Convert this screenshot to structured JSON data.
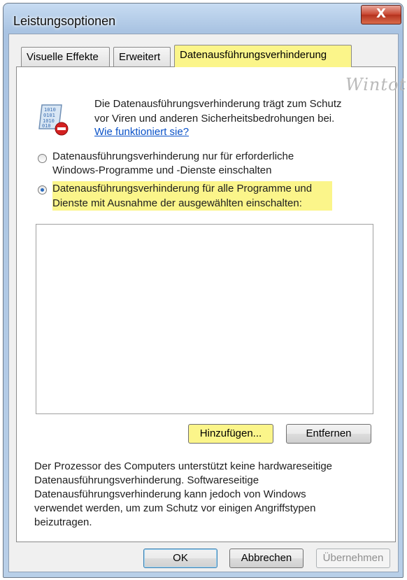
{
  "window": {
    "title": "Leistungsoptionen",
    "close_label": "X"
  },
  "tabs": [
    {
      "label": "Visuelle Effekte",
      "active": false
    },
    {
      "label": "Erweitert",
      "active": false
    },
    {
      "label": "Datenausführungsverhinderung",
      "active": true
    }
  ],
  "watermark": "Wintotal",
  "info": {
    "line1": "Die Datenausführungsverhinderung trägt zum Schutz",
    "line2": "vor Viren und anderen Sicherheitsbedrohungen bei.",
    "link": "Wie funktioniert sie?"
  },
  "options": {
    "option1_line1": "Datenausführungsverhinderung nur für erforderliche",
    "option1_line2": "Windows-Programme und -Dienste einschalten",
    "option2_line1": "Datenausführungsverhinderung für alle Programme und",
    "option2_line2": "Dienste mit Ausnahme der ausgewählten einschalten:",
    "selected": 2
  },
  "list_buttons": {
    "add": "Hinzufügen...",
    "remove": "Entfernen"
  },
  "note": {
    "line1": "Der Prozessor des Computers unterstützt keine hardwareseitige",
    "line2": "Datenausführungsverhinderung. Softwareseitige",
    "line3": "Datenausführungsverhinderung kann jedoch von Windows",
    "line4": "verwendet werden, um zum Schutz vor einigen Angriffstypen",
    "line5": "beizutragen."
  },
  "footer": {
    "ok": "OK",
    "cancel": "Abbrechen",
    "apply": "Übernehmen"
  },
  "colors": {
    "highlight": "#fbf58a",
    "link": "#0a52c8",
    "close": "#c9452f"
  },
  "icons": {
    "dep": "dep-shield-icon"
  }
}
